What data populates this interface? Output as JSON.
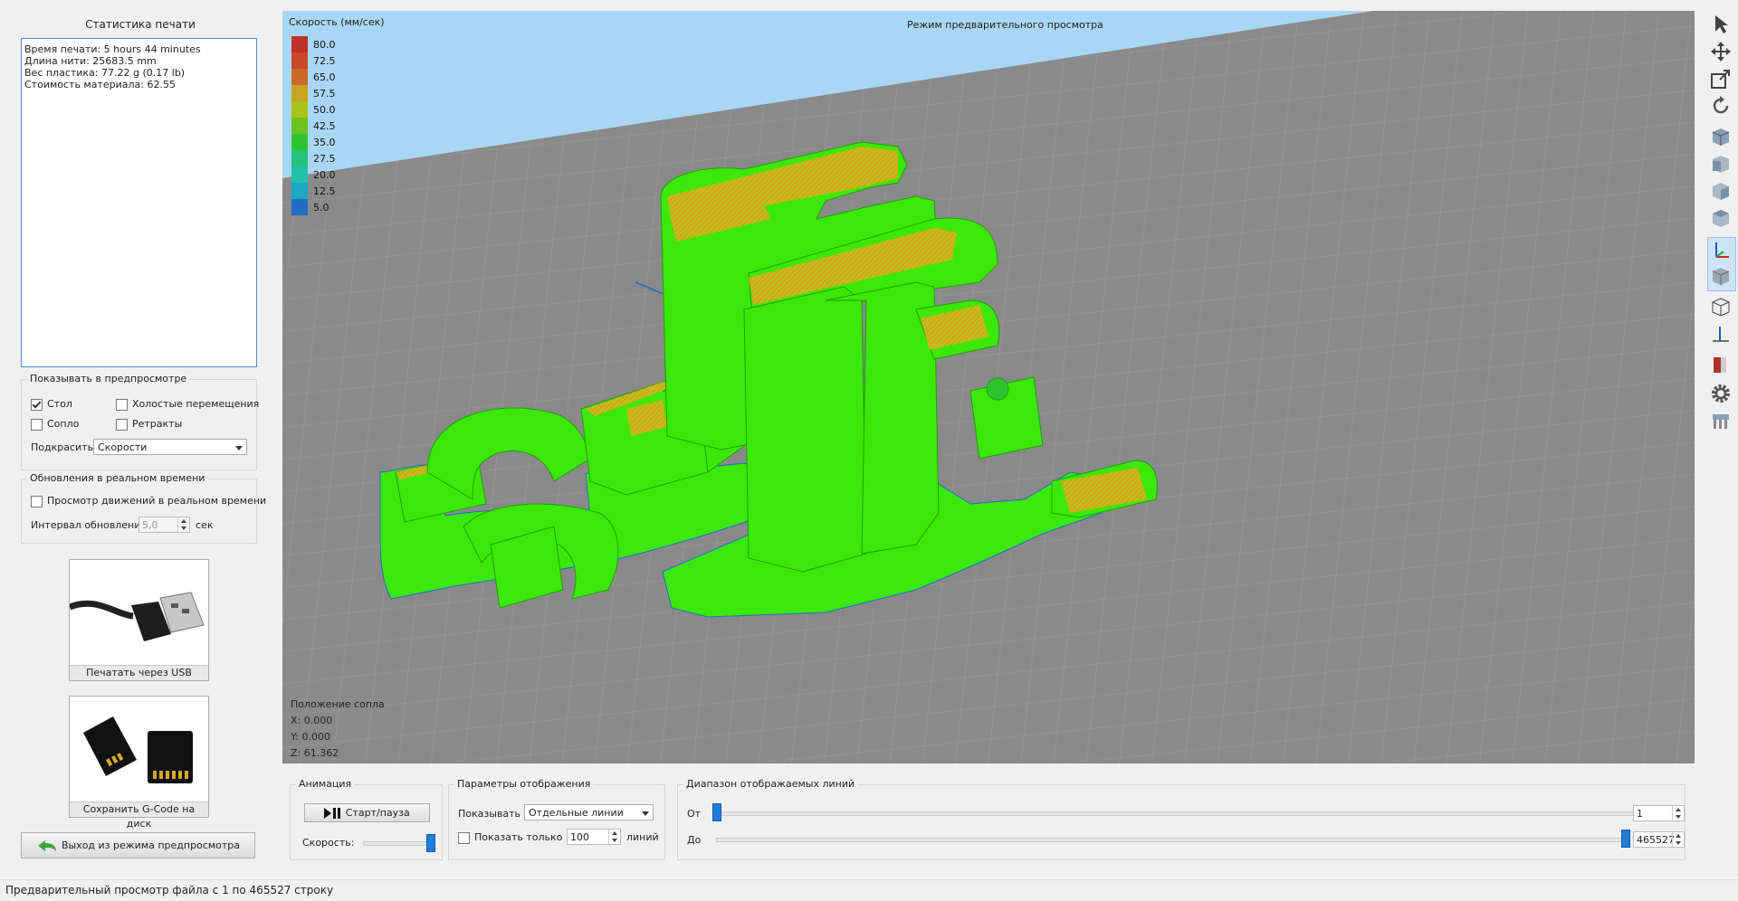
{
  "stats": {
    "title": "Статистика печати",
    "lines": [
      "Время печати: 5 hours 44 minutes",
      "Длина нити: 25683.5 mm",
      "Вес пластика: 77.22 g (0.17 lb)",
      "Стоимость материала: 62.55"
    ]
  },
  "preview_options": {
    "title": "Показывать в предпросмотре",
    "table_label": "Стол",
    "table_checked": true,
    "travel_label": "Холостые перемещения",
    "travel_checked": false,
    "nozzle_label": "Сопло",
    "nozzle_checked": false,
    "retract_label": "Ретракты",
    "retract_checked": false,
    "color_label": "Подкрасить",
    "color_value": "Скорости"
  },
  "realtime": {
    "title": "Обновления в реальном времени",
    "moves_label": "Просмотр движений в реальном времени",
    "moves_checked": false,
    "interval_label": "Интервал обновления",
    "interval_value": "5,0",
    "interval_unit": "сек"
  },
  "usb_button": {
    "label": "Печатать через USB",
    "icon": "usb-cable-icon"
  },
  "sd_button": {
    "label": "Сохранить G-Code на диск",
    "icon": "sd-card-icon"
  },
  "exit_button": {
    "label": "Выход из режима предпросмотра",
    "icon": "back-arrow-icon"
  },
  "viewport": {
    "mode_label": "Режим предварительного просмотра",
    "legend_title": "Скорость (мм/сек)",
    "legend": [
      {
        "value": "80.0",
        "color": "#c0302a"
      },
      {
        "value": "72.5",
        "color": "#c8492a"
      },
      {
        "value": "65.0",
        "color": "#c86b28"
      },
      {
        "value": "57.5",
        "color": "#c8a324"
      },
      {
        "value": "50.0",
        "color": "#a9c21e"
      },
      {
        "value": "42.5",
        "color": "#6cc21e"
      },
      {
        "value": "35.0",
        "color": "#2ec431"
      },
      {
        "value": "27.5",
        "color": "#25c27a"
      },
      {
        "value": "20.0",
        "color": "#22c0a4"
      },
      {
        "value": "12.5",
        "color": "#1fa6c2"
      },
      {
        "value": "5.0",
        "color": "#1f6ec2"
      }
    ],
    "nozzle_title": "Положение сопла",
    "nozzle_x": "X: 0.000",
    "nozzle_y": "Y: 0.000",
    "nozzle_z": "Z: 61.362",
    "colors": {
      "bed": "#8a8a8a",
      "sky": "#aad6f5",
      "part": "#3ce80a",
      "infill": "#d8a41a"
    }
  },
  "animation": {
    "title": "Анимация",
    "play_label": "Старт/пауза",
    "speed_label": "Скорость:",
    "speed_fraction": 1.0
  },
  "display": {
    "title": "Параметры отображения",
    "show_label": "Показывать",
    "show_value": "Отдельные линии",
    "only_label": "Показать только",
    "only_checked": false,
    "only_value": "100",
    "only_unit": "линий"
  },
  "range": {
    "title": "Диапазон отображаемых линий",
    "from_label": "От",
    "from_value": "1",
    "to_label": "До",
    "to_value": "465527"
  },
  "toolbar": {
    "icons": [
      "select-arrow-icon",
      "move-icon",
      "scale-icon",
      "rotate-icon",
      "view-cube-icon",
      "view-front-icon",
      "view-side-icon",
      "view-top-icon",
      "axes-icon",
      "solid-view-icon",
      "wireframe-view-icon",
      "single-axis-icon",
      "book-icon",
      "settings-gear-icon",
      "printer-icon"
    ]
  },
  "status": {
    "text": "Предварительный просмотр файла с 1 по 465527 строку"
  }
}
